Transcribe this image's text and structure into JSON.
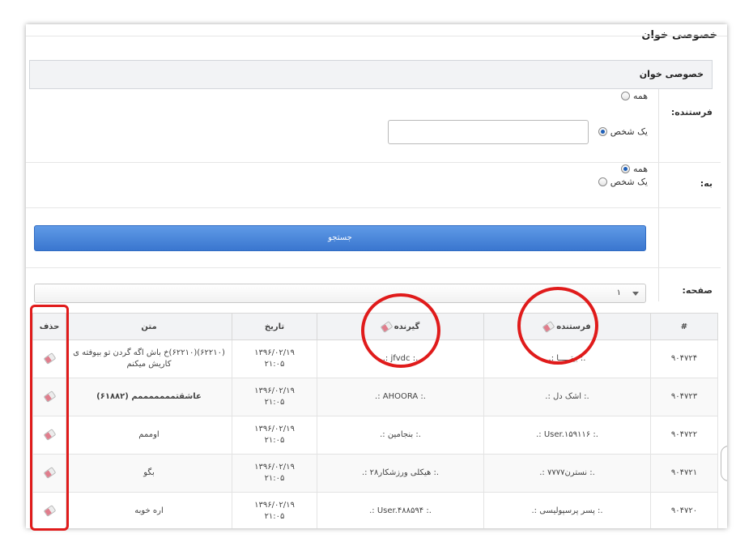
{
  "page": {
    "title": "خصوصی خوان"
  },
  "filter": {
    "section_title": "خصوصی خوان",
    "sender_label": "فرستنده:",
    "recipient_label": "به:",
    "all_label": "همه",
    "one_person_label": "یک شخص",
    "search_label": "جستجو",
    "page_label": "صفحه:",
    "page_value": "۱",
    "sender_value": ""
  },
  "table": {
    "headers": [
      "#",
      "فرستنده",
      "گیرنده",
      "تاریخ",
      "متن",
      "حذف"
    ],
    "rows": [
      {
        "id": "۹۰۴۷۲۴",
        "sender": ".: بیتـــــا :.",
        "recipient": ".: jfvdc :.",
        "date": "۱۳۹۶/۰۲/۱۹",
        "time": "۲۱:۰۵",
        "text": "(۶۲۲۱۰)(۶۲۲۱۰)خ باش اگه گردن تو بیوفته ی کاریش میکنم",
        "bold": false
      },
      {
        "id": "۹۰۴۷۲۳",
        "sender": ".: اشک دل :.",
        "recipient": ".: AHOORA :.",
        "date": "۱۳۹۶/۰۲/۱۹",
        "time": "۲۱:۰۵",
        "text": "عاشقتمممممممم (۶۱۸۸۲)",
        "bold": true
      },
      {
        "id": "۹۰۴۷۲۲",
        "sender": ".: User.۱۵۹۱۱۶ :.",
        "recipient": ".: بنجامین :.",
        "date": "۱۳۹۶/۰۲/۱۹",
        "time": "۲۱:۰۵",
        "text": "اوممم",
        "bold": false
      },
      {
        "id": "۹۰۴۷۲۱",
        "sender": ".: نسترن۷۷۷۷ :.",
        "recipient": ".: هیکلی ورزشکار۲۸ :.",
        "date": "۱۳۹۶/۰۲/۱۹",
        "time": "۲۱:۰۵",
        "text": "بگو",
        "bold": false
      },
      {
        "id": "۹۰۴۷۲۰",
        "sender": ".: پسر پرسپولیسی :.",
        "recipient": ".: User.۴۸۸۵۹۴ :.",
        "date": "۱۳۹۶/۰۲/۱۹",
        "time": "۲۱:۰۵",
        "text": "اره خوبه",
        "bold": false
      }
    ]
  },
  "colors": {
    "highlight": "#e01b1b",
    "button": "#3a76cf",
    "header_bg": "#f2f3f5"
  }
}
